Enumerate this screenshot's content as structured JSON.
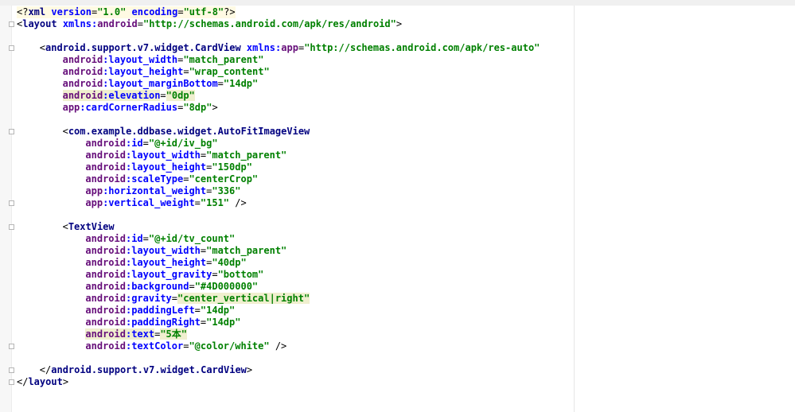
{
  "editor": {
    "language": "xml",
    "lines": [
      {
        "indent": 0,
        "fold": false,
        "tokens": [
          {
            "t": "<?",
            "c": "t-plain"
          },
          {
            "t": "xml",
            "c": "t-tag"
          },
          {
            "t": " ",
            "c": "t-plain"
          },
          {
            "t": "version",
            "c": "t-attr"
          },
          {
            "t": "=",
            "c": "t-plain"
          },
          {
            "t": "\"1.0\"",
            "c": "t-val"
          },
          {
            "t": " ",
            "c": "t-plain"
          },
          {
            "t": "encoding",
            "c": "t-attr"
          },
          {
            "t": "=",
            "c": "t-plain"
          },
          {
            "t": "\"utf-8\"",
            "c": "t-val"
          },
          {
            "t": "?>",
            "c": "t-plain"
          }
        ]
      },
      {
        "indent": 0,
        "fold": true,
        "tokens": [
          {
            "t": "<",
            "c": "t-plain"
          },
          {
            "t": "layout",
            "c": "t-tag"
          },
          {
            "t": " ",
            "c": "t-plain"
          },
          {
            "t": "xmlns:",
            "c": "t-attr"
          },
          {
            "t": "android",
            "c": "t-ns"
          },
          {
            "t": "=",
            "c": "t-plain"
          },
          {
            "t": "\"http://schemas.android.com/apk/res/android\"",
            "c": "t-val"
          },
          {
            "t": ">",
            "c": "t-plain"
          }
        ]
      },
      {
        "indent": 0,
        "fold": false,
        "tokens": []
      },
      {
        "indent": 4,
        "fold": true,
        "tokens": [
          {
            "t": "<",
            "c": "t-plain"
          },
          {
            "t": "android.support.v7.widget.CardView",
            "c": "t-tag"
          },
          {
            "t": " ",
            "c": "t-plain"
          },
          {
            "t": "xmlns:",
            "c": "t-attr"
          },
          {
            "t": "app",
            "c": "t-ns"
          },
          {
            "t": "=",
            "c": "t-plain"
          },
          {
            "t": "\"http://schemas.android.com/apk/res-auto\"",
            "c": "t-val"
          }
        ]
      },
      {
        "indent": 8,
        "fold": false,
        "tokens": [
          {
            "t": "android",
            "c": "t-ns"
          },
          {
            "t": ":layout_width",
            "c": "t-attr"
          },
          {
            "t": "=",
            "c": "t-plain"
          },
          {
            "t": "\"match_parent\"",
            "c": "t-val"
          }
        ]
      },
      {
        "indent": 8,
        "fold": false,
        "tokens": [
          {
            "t": "android",
            "c": "t-ns"
          },
          {
            "t": ":layout_height",
            "c": "t-attr"
          },
          {
            "t": "=",
            "c": "t-plain"
          },
          {
            "t": "\"wrap_content\"",
            "c": "t-val"
          }
        ]
      },
      {
        "indent": 8,
        "fold": false,
        "tokens": [
          {
            "t": "android",
            "c": "t-ns"
          },
          {
            "t": ":layout_marginBottom",
            "c": "t-attr"
          },
          {
            "t": "=",
            "c": "t-plain"
          },
          {
            "t": "\"14dp\"",
            "c": "t-val"
          }
        ]
      },
      {
        "indent": 8,
        "fold": false,
        "highlight": true,
        "tokens": [
          {
            "t": "android",
            "c": "t-ns"
          },
          {
            "t": ":elevation",
            "c": "t-attr"
          },
          {
            "t": "=",
            "c": "t-plain"
          },
          {
            "t": "\"0dp\"",
            "c": "t-val"
          }
        ]
      },
      {
        "indent": 8,
        "fold": false,
        "tokens": [
          {
            "t": "app",
            "c": "t-ns"
          },
          {
            "t": ":cardCornerRadius",
            "c": "t-attr"
          },
          {
            "t": "=",
            "c": "t-plain"
          },
          {
            "t": "\"8dp\"",
            "c": "t-val"
          },
          {
            "t": ">",
            "c": "t-plain"
          }
        ]
      },
      {
        "indent": 0,
        "fold": false,
        "tokens": []
      },
      {
        "indent": 8,
        "fold": true,
        "tokens": [
          {
            "t": "<",
            "c": "t-plain"
          },
          {
            "t": "com.example.ddbase.widget.AutoFitImageView",
            "c": "t-tag"
          }
        ]
      },
      {
        "indent": 12,
        "fold": false,
        "tokens": [
          {
            "t": "android",
            "c": "t-ns"
          },
          {
            "t": ":id",
            "c": "t-attr"
          },
          {
            "t": "=",
            "c": "t-plain"
          },
          {
            "t": "\"@+id/iv_bg\"",
            "c": "t-val"
          }
        ]
      },
      {
        "indent": 12,
        "fold": false,
        "tokens": [
          {
            "t": "android",
            "c": "t-ns"
          },
          {
            "t": ":layout_width",
            "c": "t-attr"
          },
          {
            "t": "=",
            "c": "t-plain"
          },
          {
            "t": "\"match_parent\"",
            "c": "t-val"
          }
        ]
      },
      {
        "indent": 12,
        "fold": false,
        "tokens": [
          {
            "t": "android",
            "c": "t-ns"
          },
          {
            "t": ":layout_height",
            "c": "t-attr"
          },
          {
            "t": "=",
            "c": "t-plain"
          },
          {
            "t": "\"150dp\"",
            "c": "t-val"
          }
        ]
      },
      {
        "indent": 12,
        "fold": false,
        "tokens": [
          {
            "t": "android",
            "c": "t-ns"
          },
          {
            "t": ":scaleType",
            "c": "t-attr"
          },
          {
            "t": "=",
            "c": "t-plain"
          },
          {
            "t": "\"centerCrop\"",
            "c": "t-val"
          }
        ]
      },
      {
        "indent": 12,
        "fold": false,
        "tokens": [
          {
            "t": "app",
            "c": "t-ns"
          },
          {
            "t": ":horizontal_weight",
            "c": "t-attr"
          },
          {
            "t": "=",
            "c": "t-plain"
          },
          {
            "t": "\"336\"",
            "c": "t-val"
          }
        ]
      },
      {
        "indent": 12,
        "fold": true,
        "tokens": [
          {
            "t": "app",
            "c": "t-ns"
          },
          {
            "t": ":vertical_weight",
            "c": "t-attr"
          },
          {
            "t": "=",
            "c": "t-plain"
          },
          {
            "t": "\"151\"",
            "c": "t-val"
          },
          {
            "t": " />",
            "c": "t-plain"
          }
        ]
      },
      {
        "indent": 0,
        "fold": false,
        "tokens": []
      },
      {
        "indent": 8,
        "fold": true,
        "tokens": [
          {
            "t": "<",
            "c": "t-plain"
          },
          {
            "t": "TextView",
            "c": "t-tag"
          }
        ]
      },
      {
        "indent": 12,
        "fold": false,
        "tokens": [
          {
            "t": "android",
            "c": "t-ns"
          },
          {
            "t": ":id",
            "c": "t-attr"
          },
          {
            "t": "=",
            "c": "t-plain"
          },
          {
            "t": "\"@+id/tv_count\"",
            "c": "t-val"
          }
        ]
      },
      {
        "indent": 12,
        "fold": false,
        "tokens": [
          {
            "t": "android",
            "c": "t-ns"
          },
          {
            "t": ":layout_width",
            "c": "t-attr"
          },
          {
            "t": "=",
            "c": "t-plain"
          },
          {
            "t": "\"match_parent\"",
            "c": "t-val"
          }
        ]
      },
      {
        "indent": 12,
        "fold": false,
        "tokens": [
          {
            "t": "android",
            "c": "t-ns"
          },
          {
            "t": ":layout_height",
            "c": "t-attr"
          },
          {
            "t": "=",
            "c": "t-plain"
          },
          {
            "t": "\"40dp\"",
            "c": "t-val"
          }
        ]
      },
      {
        "indent": 12,
        "fold": false,
        "tokens": [
          {
            "t": "android",
            "c": "t-ns"
          },
          {
            "t": ":layout_gravity",
            "c": "t-attr"
          },
          {
            "t": "=",
            "c": "t-plain"
          },
          {
            "t": "\"bottom\"",
            "c": "t-val"
          }
        ]
      },
      {
        "indent": 12,
        "fold": false,
        "tokens": [
          {
            "t": "android",
            "c": "t-ns"
          },
          {
            "t": ":background",
            "c": "t-attr"
          },
          {
            "t": "=",
            "c": "t-plain"
          },
          {
            "t": "\"#4D000000\"",
            "c": "t-val"
          }
        ]
      },
      {
        "indent": 12,
        "fold": false,
        "tokens": [
          {
            "t": "android",
            "c": "t-ns"
          },
          {
            "t": ":gravity",
            "c": "t-attr"
          },
          {
            "t": "=",
            "c": "t-plain"
          },
          {
            "t": "\"center_vertical|right\"",
            "c": "t-val",
            "hl": true
          }
        ]
      },
      {
        "indent": 12,
        "fold": false,
        "tokens": [
          {
            "t": "android",
            "c": "t-ns"
          },
          {
            "t": ":paddingLeft",
            "c": "t-attr"
          },
          {
            "t": "=",
            "c": "t-plain"
          },
          {
            "t": "\"14dp\"",
            "c": "t-val"
          }
        ]
      },
      {
        "indent": 12,
        "fold": false,
        "tokens": [
          {
            "t": "android",
            "c": "t-ns"
          },
          {
            "t": ":paddingRight",
            "c": "t-attr"
          },
          {
            "t": "=",
            "c": "t-plain"
          },
          {
            "t": "\"14dp\"",
            "c": "t-val"
          }
        ]
      },
      {
        "indent": 12,
        "fold": false,
        "highlight": true,
        "tokens": [
          {
            "t": "android",
            "c": "t-ns"
          },
          {
            "t": ":text",
            "c": "t-attr"
          },
          {
            "t": "=",
            "c": "t-plain"
          },
          {
            "t": "\"5本\"",
            "c": "t-val"
          }
        ]
      },
      {
        "indent": 12,
        "fold": true,
        "tokens": [
          {
            "t": "android",
            "c": "t-ns"
          },
          {
            "t": ":textColor",
            "c": "t-attr"
          },
          {
            "t": "=",
            "c": "t-plain"
          },
          {
            "t": "\"@color/white\"",
            "c": "t-val"
          },
          {
            "t": " />",
            "c": "t-plain"
          }
        ]
      },
      {
        "indent": 0,
        "fold": false,
        "tokens": []
      },
      {
        "indent": 4,
        "fold": true,
        "tokens": [
          {
            "t": "</",
            "c": "t-plain"
          },
          {
            "t": "android.support.v7.widget.CardView",
            "c": "t-tag"
          },
          {
            "t": ">",
            "c": "t-plain"
          }
        ]
      },
      {
        "indent": 0,
        "fold": true,
        "tokens": [
          {
            "t": "</",
            "c": "t-plain"
          },
          {
            "t": "layout",
            "c": "t-tag"
          },
          {
            "t": ">",
            "c": "t-plain"
          }
        ]
      }
    ]
  }
}
